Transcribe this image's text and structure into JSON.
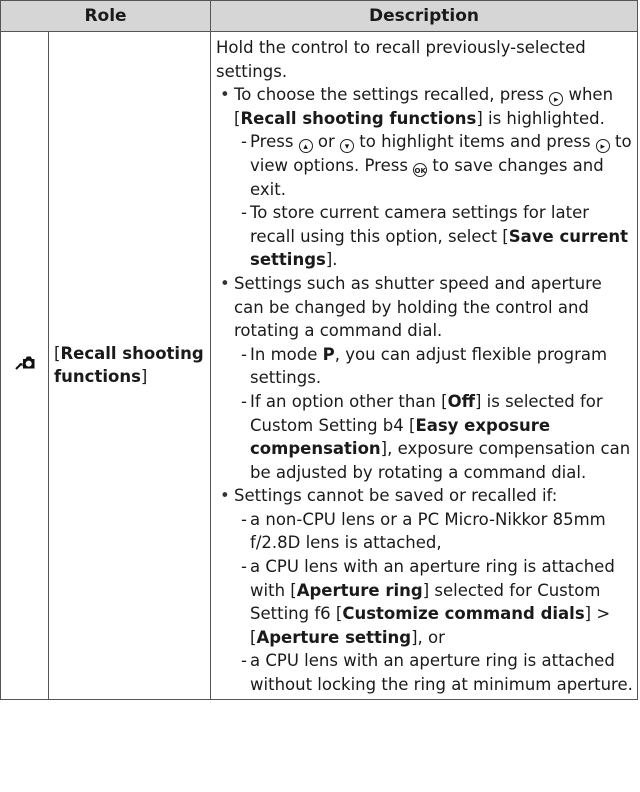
{
  "table": {
    "header_role": "Role",
    "header_description": "Description"
  },
  "row": {
    "icon": "recall-shooting-camera-icon",
    "role_open": "[",
    "role_bold": "Recall shooting functions",
    "role_close": "]",
    "intro": "Hold the control to recall previously-selected settings.",
    "b1": {
      "t1": "To choose the settings recalled, press ",
      "t2": " when [",
      "bold": "Recall shooting functions",
      "t3": "] is highlighted."
    },
    "s1": {
      "t1": "Press ",
      "t2": " or ",
      "t3": " to highlight items and press ",
      "t4": " to view options. Press ",
      "t5": " to save changes and exit."
    },
    "s2": {
      "t1": "To store current camera settings for later recall using this option, select [",
      "bold": "Save current settings",
      "t2": "]."
    },
    "b2": "Settings such as shutter speed and aperture can be changed by holding the control and rotating a command dial.",
    "s3": {
      "t1": "In mode ",
      "bold": "P",
      "t2": ", you can adjust flexible program settings."
    },
    "s4": {
      "t1": "If an option other than [",
      "bold1": "Off",
      "t2": "] is selected for Custom Setting b4 [",
      "bold2": "Easy exposure compensation",
      "t3": "], exposure compensation can be adjusted by rotating a command dial."
    },
    "b3": "Settings cannot be saved or recalled if:",
    "s5": "a non-CPU lens or a PC Micro-Nikkor 85mm f/2.8D lens is attached,",
    "s6": {
      "t1": "a CPU lens with an aperture ring is attached with [",
      "bold1": "Aperture ring",
      "t2": "] selected for Custom Setting f6 [",
      "bold2": "Customize command dials",
      "t3": "] > [",
      "bold3": "Aperture setting",
      "t4": "], or"
    },
    "s7": "a CPU lens with an aperture ring is attached without locking the ring at minimum aperture."
  },
  "glyphs": {
    "right": "▸",
    "up": "▴",
    "down": "▾",
    "ok": "OK"
  }
}
